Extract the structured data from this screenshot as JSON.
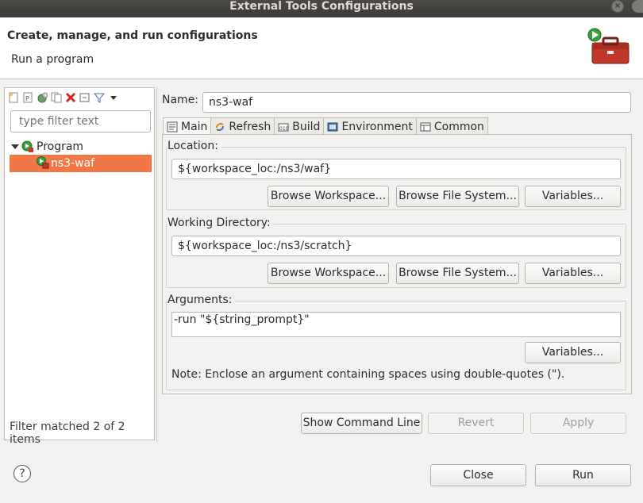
{
  "window": {
    "title": "External Tools Configurations"
  },
  "header": {
    "title": "Create, manage, and run configurations",
    "subtitle": "Run a program",
    "icon": "toolbox-run-icon"
  },
  "left": {
    "toolbar_icons": [
      "new-config-icon",
      "new-prototype-icon",
      "export-icon",
      "duplicate-icon",
      "delete-icon",
      "collapse-all-icon",
      "filter-icon",
      "view-menu-icon"
    ],
    "filter_placeholder": "type filter text",
    "tree": {
      "category": "Program",
      "selected_item": "ns3-waf"
    },
    "status": "Filter matched 2 of 2 items"
  },
  "config": {
    "name_label": "Name:",
    "name_value": "ns3-waf",
    "tabs": [
      {
        "label": "Main",
        "icon": "main-tab-icon"
      },
      {
        "label": "Refresh",
        "icon": "refresh-icon"
      },
      {
        "label": "Build",
        "icon": "build-icon"
      },
      {
        "label": "Environment",
        "icon": "environment-icon"
      },
      {
        "label": "Common",
        "icon": "common-icon"
      }
    ],
    "location": {
      "label": "Location:",
      "value": "${workspace_loc:/ns3/waf}",
      "browse_workspace": "Browse Workspace...",
      "browse_fs": "Browse File System...",
      "variables": "Variables..."
    },
    "working_dir": {
      "label": "Working Directory:",
      "value": "${workspace_loc:/ns3/scratch}",
      "browse_workspace": "Browse Workspace...",
      "browse_fs": "Browse File System...",
      "variables": "Variables..."
    },
    "arguments": {
      "label": "Arguments:",
      "value": "-run \"${string_prompt}\"",
      "variables": "Variables...",
      "note": "Note: Enclose an argument containing spaces using double-quotes (\")."
    },
    "show_command_line": "Show Command Line",
    "revert": "Revert",
    "apply": "Apply"
  },
  "footer": {
    "close": "Close",
    "run": "Run"
  },
  "colors": {
    "selection": "#f07746",
    "titlebar": "#3b3a36"
  }
}
